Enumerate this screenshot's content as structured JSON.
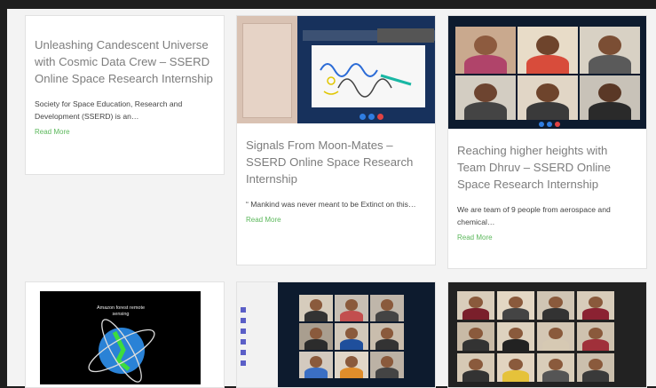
{
  "cards": [
    {
      "title": "Unleashing Candescent Universe with Cosmic Data Crew – SSERD Online Space Research Internship",
      "excerpt": "Society for Space Education, Research and Development (SSERD) is an…",
      "read_more": "Read More"
    },
    {
      "title": "Signals From Moon-Mates – SSERD Online Space Research Internship",
      "excerpt": "“ Mankind was never meant to be Extinct on this…",
      "read_more": "Read More"
    },
    {
      "title": "Reaching higher heights with Team Dhruv – SSERD Online Space Research Internship",
      "excerpt": "We are team of 9 people from aerospace and chemical…",
      "read_more": "Read More"
    }
  ],
  "bottom_thumbs": [
    {
      "label": "Amazon forest remote sensing"
    }
  ],
  "colors": {
    "page_background": "#1e1e1e",
    "grid_background": "#f3f3f3",
    "title": "#7d7d7d",
    "read_more": "#5cb85c",
    "call_app": "#0d1b2e"
  }
}
